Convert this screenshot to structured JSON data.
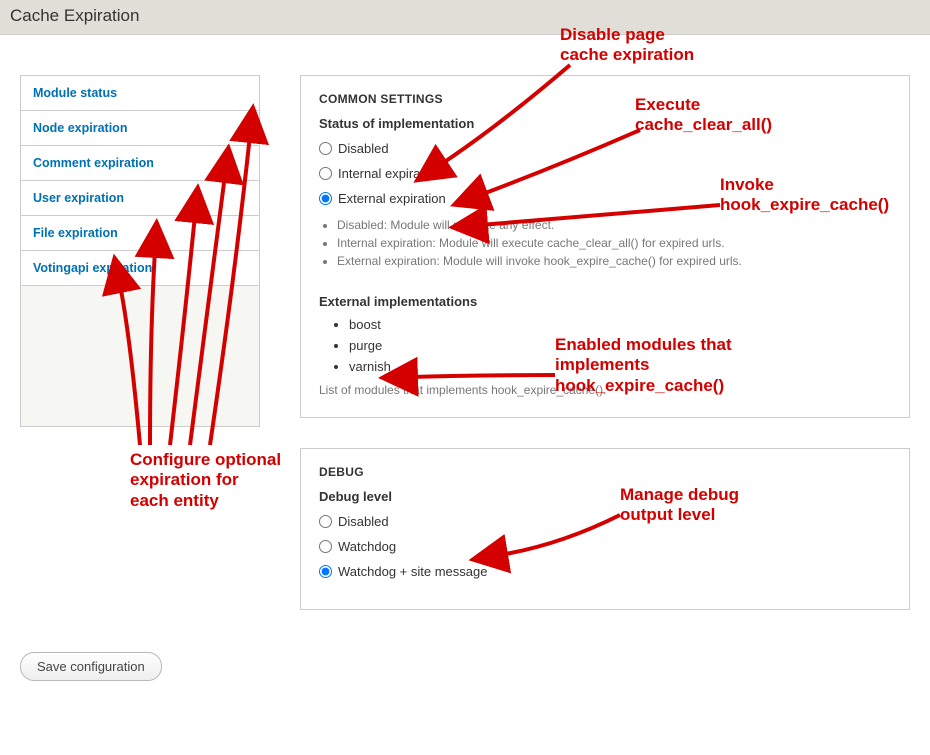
{
  "page_title": "Cache Expiration",
  "sidebar": {
    "items": [
      {
        "label": "Module status"
      },
      {
        "label": "Node expiration"
      },
      {
        "label": "Comment expiration"
      },
      {
        "label": "User expiration"
      },
      {
        "label": "File expiration"
      },
      {
        "label": "Votingapi expiration"
      }
    ]
  },
  "common": {
    "legend": "COMMON SETTINGS",
    "status_label": "Status of implementation",
    "radios": {
      "disabled": "Disabled",
      "internal": "Internal expiration",
      "external": "External expiration"
    },
    "selected": "external",
    "desc": {
      "d1": "Disabled: Module will not take any effect.",
      "d2": "Internal expiration: Module will execute cache_clear_all() for expired urls.",
      "d3": "External expiration: Module will invoke hook_expire_cache() for expired urls."
    },
    "ext_label": "External implementations",
    "modules": [
      "boost",
      "purge",
      "varnish"
    ],
    "modules_desc": "List of modules that implements hook_expire_cache()."
  },
  "debug": {
    "legend": "DEBUG",
    "label": "Debug level",
    "radios": {
      "disabled": "Disabled",
      "watchdog": "Watchdog",
      "watchdog_msg": "Watchdog + site message"
    },
    "selected": "watchdog_msg"
  },
  "buttons": {
    "save": "Save configuration"
  },
  "annotations": {
    "a1": "Disable page\ncache expiration",
    "a2": "Execute\ncache_clear_all()",
    "a3": "Invoke\nhook_expire_cache()",
    "a4": "Enabled modules that\nimplements\nhook_expire_cache()",
    "a5": "Manage debug\noutput level",
    "a6": "Configure optional\nexpiration for\neach entity"
  }
}
